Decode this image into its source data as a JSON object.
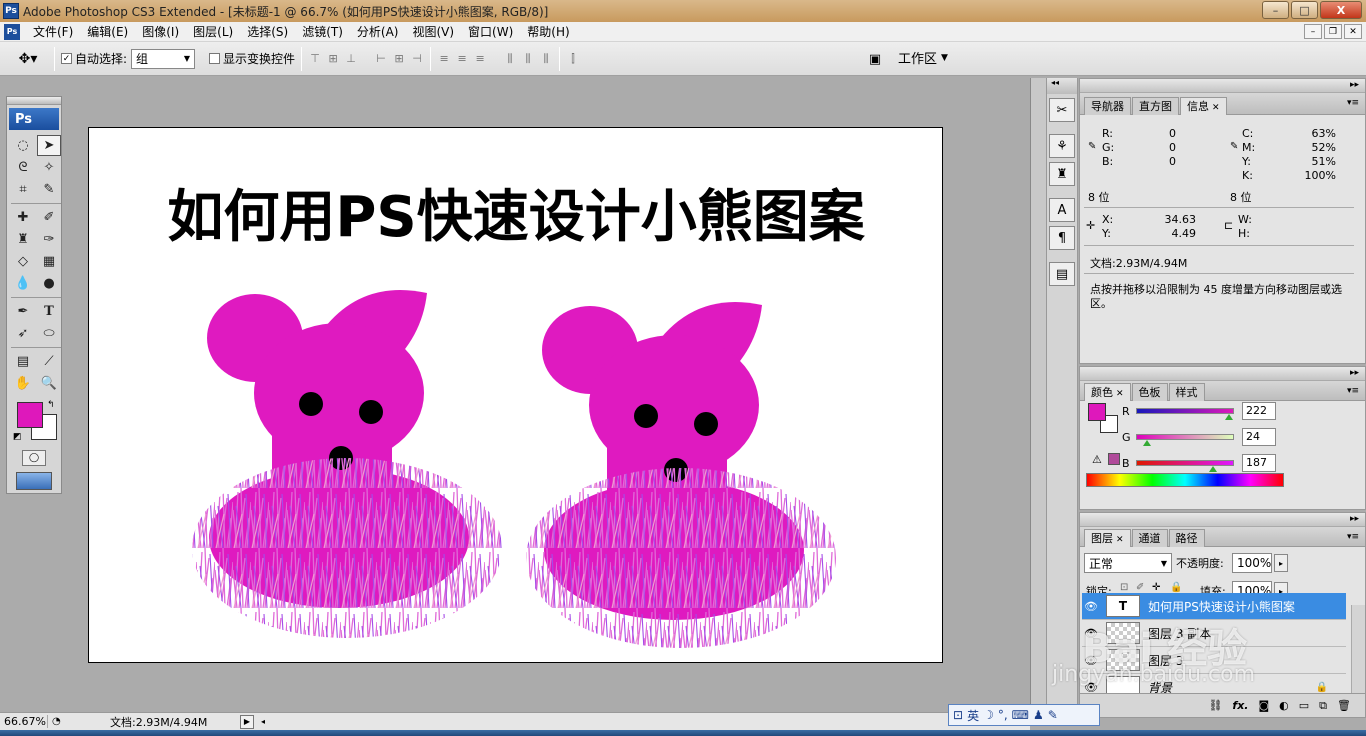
{
  "titlebar": {
    "logo": "Ps",
    "title": "Adobe Photoshop CS3 Extended - [未标题-1 @ 66.7% (如何用PS快速设计小熊图案, RGB/8)]",
    "minimize": "–",
    "maximize": "□",
    "close": "X"
  },
  "menu": {
    "items": [
      "文件(F)",
      "编辑(E)",
      "图像(I)",
      "图层(L)",
      "选择(S)",
      "滤镜(T)",
      "分析(A)",
      "视图(V)",
      "窗口(W)",
      "帮助(H)"
    ]
  },
  "options": {
    "auto_select_label": "自动选择:",
    "auto_select_value": "组",
    "show_transform_label": "显示变换控件",
    "workspace_label": "工作区"
  },
  "canvas": {
    "headline": "如何用PS快速设计小熊图案"
  },
  "info_panel": {
    "tabs": [
      "导航器",
      "直方图",
      "信息"
    ],
    "r_label": "R:",
    "r_value": "0",
    "g_label": "G:",
    "g_value": "0",
    "b_label": "B:",
    "b_value": "0",
    "c_label": "C:",
    "c_value": "63%",
    "m_label": "M:",
    "m_value": "52%",
    "y_label": "Y:",
    "y_value": "51%",
    "k_label": "K:",
    "k_value": "100%",
    "bits_left": "8 位",
    "bits_right": "8 位",
    "x_label": "X:",
    "x_value": "34.63",
    "ypos_label": "Y:",
    "ypos_value": "4.49",
    "w_label": "W:",
    "h_label": "H:",
    "doc_size": "文档:2.93M/4.94M",
    "hint": "点按并拖移以沿限制为 45 度增量方向移动图层或选区。"
  },
  "color_panel": {
    "tabs": [
      "颜色",
      "色板",
      "样式"
    ],
    "r_label": "R",
    "r_value": "222",
    "g_label": "G",
    "g_value": "24",
    "b_label": "B",
    "b_value": "187",
    "fg_color": "#de18bb"
  },
  "layers_panel": {
    "tabs": [
      "图层",
      "通道",
      "路径"
    ],
    "blend_mode": "正常",
    "opacity_label": "不透明度:",
    "opacity_value": "100%",
    "lock_label": "锁定:",
    "fill_label": "填充:",
    "fill_value": "100%",
    "layers": [
      {
        "name": "如何用PS快速设计小熊图案",
        "thumb": "T"
      },
      {
        "name": "图层 3 副本",
        "thumb": ""
      },
      {
        "name": "图层 3",
        "thumb": ""
      },
      {
        "name": "背景",
        "thumb": ""
      }
    ],
    "footer_fx": "fx."
  },
  "status": {
    "zoom": "66.67%",
    "doc_info": "文档:2.93M/4.94M"
  },
  "ime": {
    "lang": "英"
  },
  "watermark": {
    "brand": "Bai 经验",
    "url": "jingyan.baidu.com"
  },
  "colors": {
    "bear_magenta": "#df1ac0",
    "selected_layer": "#3a8ce2"
  }
}
